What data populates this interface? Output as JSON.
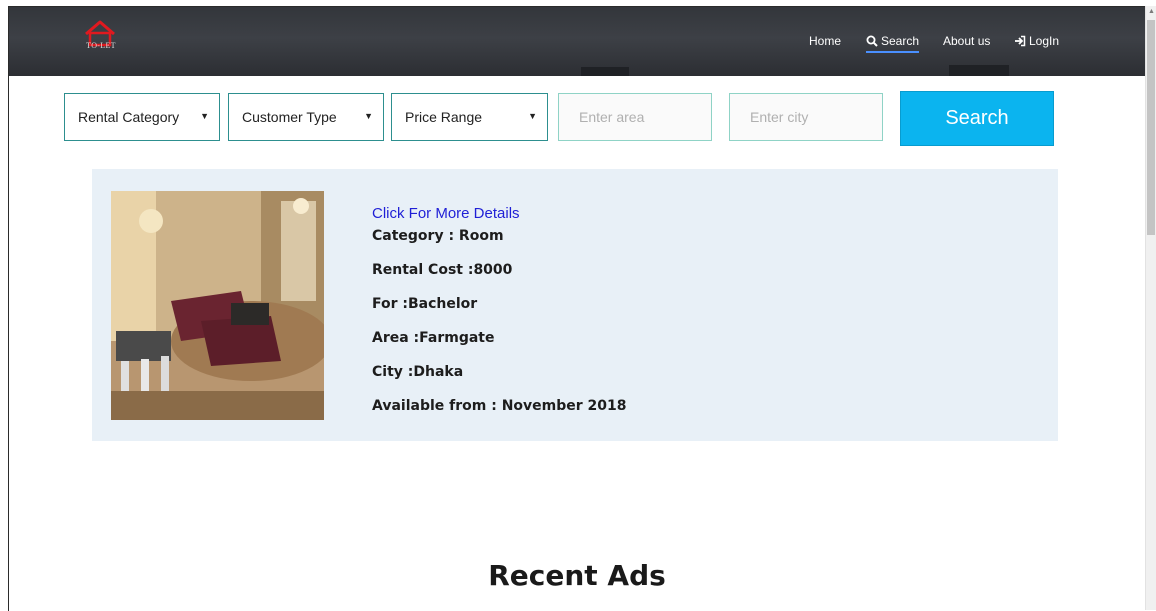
{
  "brand": {
    "logo_text": "TO-LET",
    "logo_color": "#e0191f"
  },
  "nav": {
    "items": [
      {
        "label": "Home",
        "icon": ""
      },
      {
        "label": "Search",
        "icon": "search-icon",
        "active": true
      },
      {
        "label": "About us",
        "icon": ""
      },
      {
        "label": "LogIn",
        "icon": "sign-in-icon"
      }
    ]
  },
  "filters": {
    "rental_category": "Rental Category",
    "customer_type": "Customer Type",
    "price_range": "Price Range",
    "area_placeholder": "Enter area",
    "city_placeholder": "Enter city",
    "search_label": "Search"
  },
  "listing": {
    "link_text": "Click For More Details",
    "category": "Category : Room",
    "rental_cost": "Rental Cost :8000",
    "for": "For :Bachelor",
    "area": "Area :Farmgate",
    "city": "City :Dhaka",
    "available": "Available from : November 2018"
  },
  "recent_ads": {
    "title": "Recent Ads"
  },
  "colors": {
    "accent": "#0bb4ef",
    "card_bg": "#e8f0f7",
    "link": "#1f1fd6",
    "border": "#2d8f8f"
  }
}
